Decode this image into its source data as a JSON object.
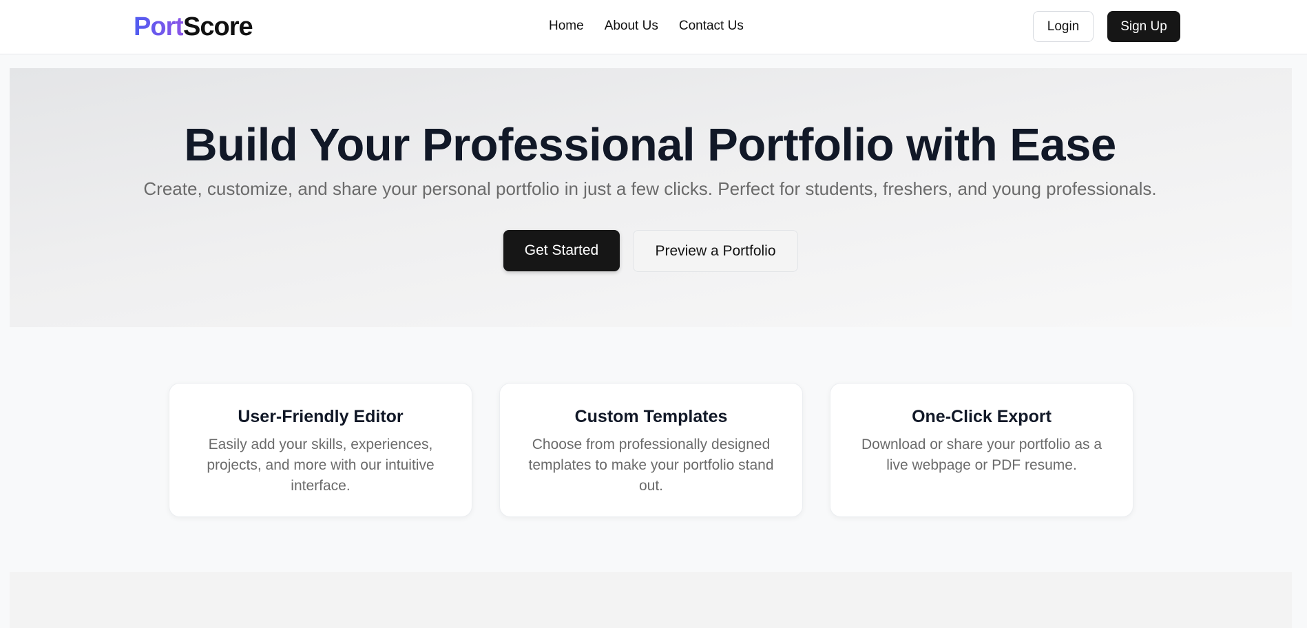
{
  "navbar": {
    "logo": {
      "part1": "Port",
      "part2": "Score"
    },
    "links": [
      "Home",
      "About Us",
      "Contact Us"
    ],
    "login_label": "Login",
    "signup_label": "Sign Up"
  },
  "hero": {
    "title": "Build Your Professional Portfolio with Ease",
    "subtitle": "Create, customize, and share your personal portfolio in just a few clicks. Perfect for students, freshers, and young professionals.",
    "primary_cta": "Get Started",
    "secondary_cta": "Preview a Portfolio"
  },
  "features": [
    {
      "title": "User-Friendly Editor",
      "description": "Easily add your skills, experiences, projects, and more with our intuitive interface."
    },
    {
      "title": "Custom Templates",
      "description": "Choose from professionally designed templates to make your portfolio stand out."
    },
    {
      "title": "One-Click Export",
      "description": "Download or share your portfolio as a live webpage or PDF resume."
    }
  ],
  "colors": {
    "logo_gradient_start": "#4f5cf0",
    "logo_gradient_end": "#8b55e8",
    "primary_button": "#161616",
    "heading_text": "#111827",
    "muted_text": "#6b6b6b"
  }
}
